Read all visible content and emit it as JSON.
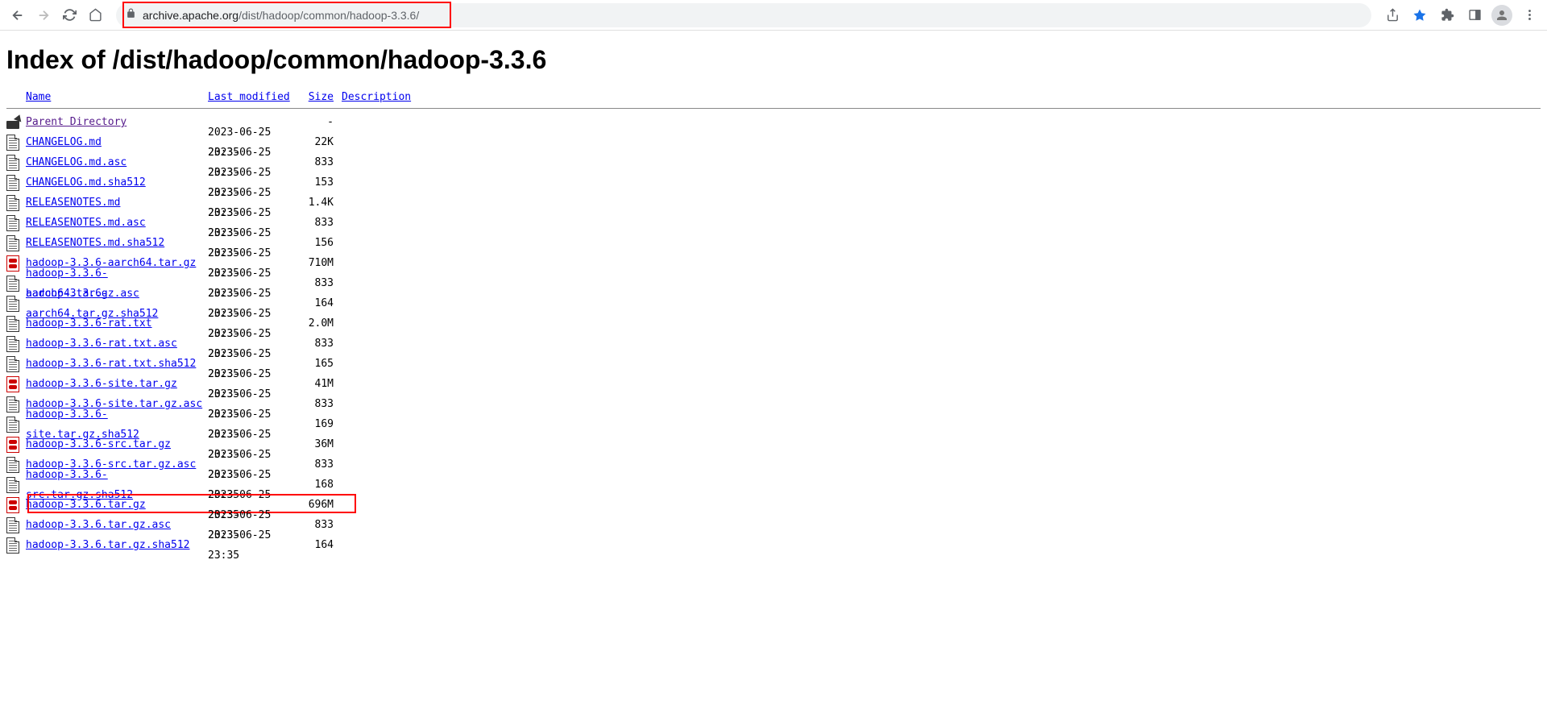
{
  "browser": {
    "url_host": "archive.apache.org",
    "url_path": "/dist/hadoop/common/hadoop-3.3.6/"
  },
  "page": {
    "title": "Index of /dist/hadoop/common/hadoop-3.3.6"
  },
  "columns": {
    "name": "Name",
    "modified": "Last modified",
    "size": "Size",
    "description": "Description"
  },
  "parent": {
    "label": "Parent Directory",
    "size": "-"
  },
  "files": [
    {
      "icon": "text",
      "name": "CHANGELOG.md",
      "modified": "2023-06-25 23:35",
      "size": "22K"
    },
    {
      "icon": "text",
      "name": "CHANGELOG.md.asc",
      "modified": "2023-06-25 23:35",
      "size": "833"
    },
    {
      "icon": "text",
      "name": "CHANGELOG.md.sha512",
      "modified": "2023-06-25 23:35",
      "size": "153"
    },
    {
      "icon": "text",
      "name": "RELEASENOTES.md",
      "modified": "2023-06-25 23:35",
      "size": "1.4K"
    },
    {
      "icon": "text",
      "name": "RELEASENOTES.md.asc",
      "modified": "2023-06-25 23:35",
      "size": "833"
    },
    {
      "icon": "text",
      "name": "RELEASENOTES.md.sha512",
      "modified": "2023-06-25 23:35",
      "size": "156"
    },
    {
      "icon": "archive",
      "name": "hadoop-3.3.6-aarch64.tar.gz",
      "modified": "2023-06-25 23:35",
      "size": "710M"
    },
    {
      "icon": "text",
      "name": "hadoop-3.3.6-aarch64.tar.gz.asc",
      "modified": "2023-06-25 23:35",
      "size": "833"
    },
    {
      "icon": "text",
      "name": "hadoop-3.3.6-aarch64.tar.gz.sha512",
      "modified": "2023-06-25 23:35",
      "size": "164"
    },
    {
      "icon": "text",
      "name": "hadoop-3.3.6-rat.txt",
      "modified": "2023-06-25 23:35",
      "size": "2.0M"
    },
    {
      "icon": "text",
      "name": "hadoop-3.3.6-rat.txt.asc",
      "modified": "2023-06-25 23:35",
      "size": "833"
    },
    {
      "icon": "text",
      "name": "hadoop-3.3.6-rat.txt.sha512",
      "modified": "2023-06-25 23:35",
      "size": "165"
    },
    {
      "icon": "archive",
      "name": "hadoop-3.3.6-site.tar.gz",
      "modified": "2023-06-25 23:35",
      "size": "41M"
    },
    {
      "icon": "text",
      "name": "hadoop-3.3.6-site.tar.gz.asc",
      "modified": "2023-06-25 23:35",
      "size": "833"
    },
    {
      "icon": "text",
      "name": "hadoop-3.3.6-site.tar.gz.sha512",
      "modified": "2023-06-25 23:35",
      "size": "169"
    },
    {
      "icon": "archive",
      "name": "hadoop-3.3.6-src.tar.gz",
      "modified": "2023-06-25 23:35",
      "size": "36M"
    },
    {
      "icon": "text",
      "name": "hadoop-3.3.6-src.tar.gz.asc",
      "modified": "2023-06-25 23:35",
      "size": "833"
    },
    {
      "icon": "text",
      "name": "hadoop-3.3.6-src.tar.gz.sha512",
      "modified": "2023-06-25 23:35",
      "size": "168"
    },
    {
      "icon": "archive",
      "name": "hadoop-3.3.6.tar.gz",
      "modified": "2023-06-25 23:35",
      "size": "696M",
      "highlight": true
    },
    {
      "icon": "text",
      "name": "hadoop-3.3.6.tar.gz.asc",
      "modified": "2023-06-25 23:35",
      "size": "833"
    },
    {
      "icon": "text",
      "name": "hadoop-3.3.6.tar.gz.sha512",
      "modified": "2023-06-25 23:35",
      "size": "164"
    }
  ]
}
